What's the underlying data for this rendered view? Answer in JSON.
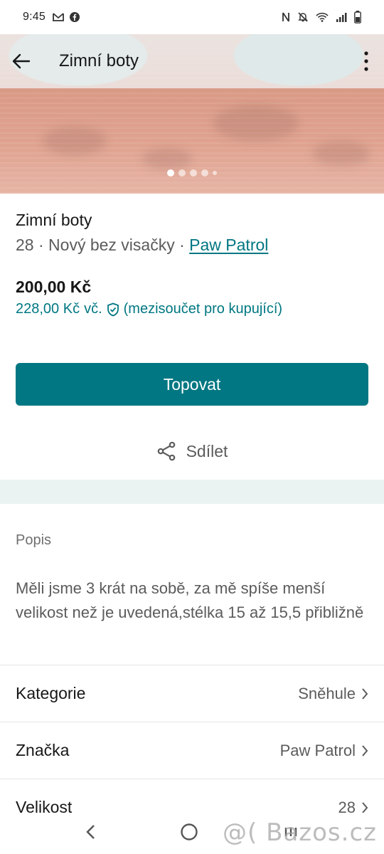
{
  "status_bar": {
    "time": "9:45"
  },
  "header": {
    "title": "Zimní boty"
  },
  "item": {
    "title": "Zimní boty",
    "size": "28",
    "condition": "Nový bez visačky",
    "separator": "·",
    "brand": "Paw Patrol",
    "price": "200,00 Kč",
    "price_incl": "228,00 Kč",
    "price_incl_suffix": "vč.",
    "price_incl_note": "(mezisoučet pro kupující)"
  },
  "actions": {
    "bump_label": "Topovat",
    "share_label": "Sdílet"
  },
  "description": {
    "label": "Popis",
    "text": "Měli jsme 3 krát na sobě, za mě spíše menší velikost než je uvedená,stélka 15 až 15,5 přibližně"
  },
  "attributes": [
    {
      "label": "Kategorie",
      "value": "Sněhule"
    },
    {
      "label": "Značka",
      "value": "Paw Patrol"
    },
    {
      "label": "Velikost",
      "value": "28"
    }
  ],
  "watermark": "@( Bazos.cz",
  "colors": {
    "accent": "#007782",
    "band": "#eaf2f2"
  }
}
